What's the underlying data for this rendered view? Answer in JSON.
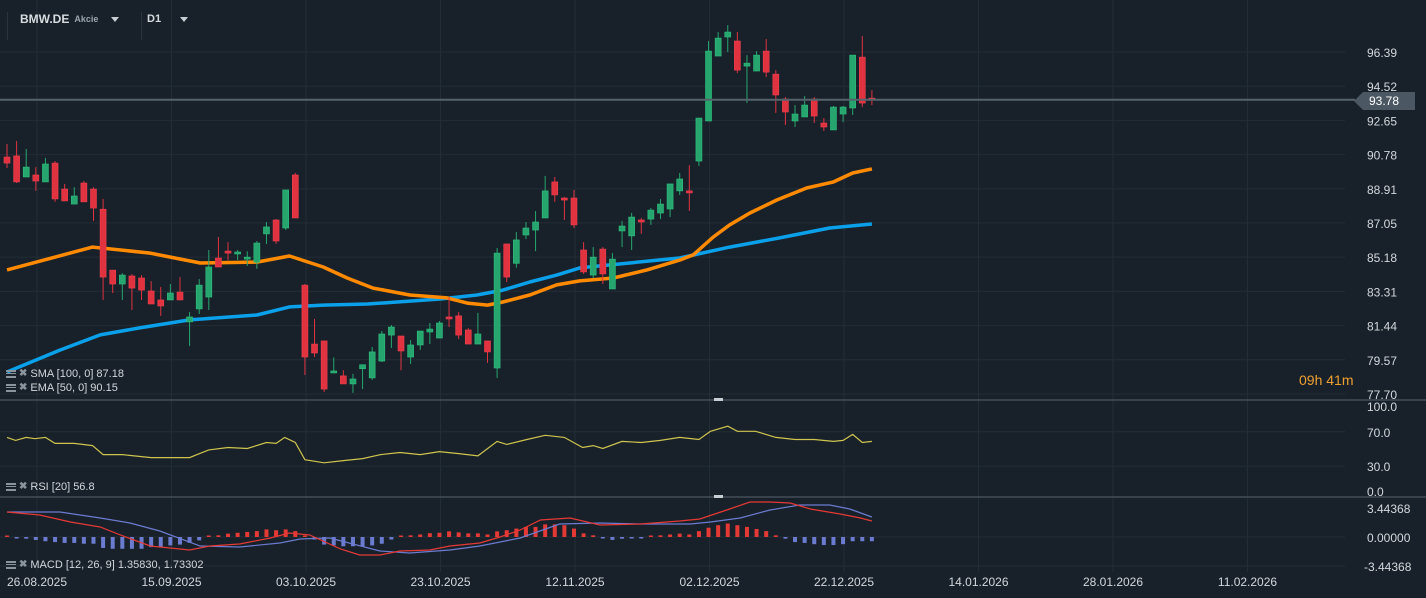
{
  "header": {
    "symbol": "BMW.DE",
    "type": "Akcie",
    "timeframe": "D1"
  },
  "indicators": {
    "sma": "SMA [100,  0] 87.18",
    "ema": "EMA [50,  0] 90.15",
    "rsi": "RSI [20]  56.8",
    "macd": "MACD [12, 26, 9] 1.35830,  1.73302"
  },
  "countdown": "09h 41m",
  "last_price": "93.78",
  "colors": {
    "bg": "#18212a",
    "up": "#26a66e",
    "down": "#e0323f",
    "ema": "#ff8a00",
    "sma": "#0aa0ea",
    "rsi": "#cfc44e",
    "macd": "#6b7bd0",
    "signal": "#e53935",
    "grid": "#232d36"
  },
  "chart_data": {
    "type": "candlestick",
    "price_axis": {
      "ticks": [
        "96.39",
        "94.52",
        "92.65",
        "90.78",
        "88.91",
        "87.05",
        "85.18",
        "83.31",
        "81.44",
        "79.57",
        "77.70"
      ],
      "range": [
        77.7,
        96.39
      ]
    },
    "time_axis": [
      "26.08.2025",
      "15.09.2025",
      "03.10.2025",
      "23.10.2025",
      "12.11.2025",
      "02.12.2025",
      "22.12.2025",
      "14.01.2026",
      "28.01.2026",
      "11.02.2026"
    ],
    "ohlc": [
      [
        90.65,
        91.36,
        90.05,
        90.32
      ],
      [
        90.71,
        91.53,
        89.23,
        89.29
      ],
      [
        89.56,
        91.09,
        89.56,
        90.1
      ],
      [
        89.67,
        90.1,
        88.8,
        89.34
      ],
      [
        89.29,
        90.6,
        89.29,
        90.27
      ],
      [
        90.32,
        90.43,
        88.2,
        88.36
      ],
      [
        88.9,
        89.18,
        88.25,
        88.25
      ],
      [
        88.08,
        89.0,
        88.08,
        88.52
      ],
      [
        89.23,
        89.34,
        88.2,
        88.2
      ],
      [
        88.9,
        89.0,
        87.16,
        87.86
      ],
      [
        87.8,
        88.36,
        82.84,
        84.09
      ],
      [
        84.47,
        84.47,
        83.22,
        83.71
      ],
      [
        83.71,
        84.3,
        82.84,
        84.2
      ],
      [
        84.15,
        84.25,
        82.29,
        83.49
      ],
      [
        84.04,
        84.2,
        82.84,
        83.38
      ],
      [
        83.33,
        83.87,
        82.62,
        82.62
      ],
      [
        82.84,
        83.55,
        81.97,
        82.51
      ],
      [
        82.84,
        83.71,
        82.84,
        83.22
      ],
      [
        83.27,
        84.09,
        82.84,
        82.84
      ],
      [
        81.64,
        82.18,
        80.32,
        81.91
      ],
      [
        82.35,
        83.98,
        82.07,
        83.65
      ],
      [
        83.0,
        85.57,
        82.29,
        84.64
      ],
      [
        85.13,
        86.28,
        84.64,
        84.64
      ],
      [
        85.51,
        86.0,
        85.0,
        85.4
      ],
      [
        85.4,
        85.57,
        85.02,
        85.46
      ],
      [
        85.07,
        85.5,
        84.7,
        85.18
      ],
      [
        84.9,
        86.06,
        84.54,
        85.95
      ],
      [
        86.45,
        87.1,
        85.9,
        86.83
      ],
      [
        87.21,
        87.26,
        85.9,
        86.06
      ],
      [
        86.77,
        88.85,
        86.66,
        88.85
      ],
      [
        89.67,
        89.78,
        87.32,
        87.32
      ],
      [
        83.65,
        83.71,
        78.74,
        79.72
      ],
      [
        80.43,
        81.8,
        79.72,
        79.94
      ],
      [
        80.6,
        80.6,
        77.81,
        77.97
      ],
      [
        78.86,
        79.7,
        78.86,
        78.96
      ],
      [
        78.69,
        79.0,
        78.25,
        78.25
      ],
      [
        78.25,
        78.8,
        77.76,
        78.52
      ],
      [
        79.08,
        79.3,
        77.97,
        79.3
      ],
      [
        78.58,
        80.27,
        78.47,
        80.0
      ],
      [
        79.5,
        81.14,
        79.45,
        80.98
      ],
      [
        80.92,
        81.47,
        80.22,
        81.36
      ],
      [
        80.87,
        80.87,
        79.0,
        80.05
      ],
      [
        79.72,
        80.65,
        79.34,
        80.38
      ],
      [
        80.38,
        81.14,
        80.11,
        81.14
      ],
      [
        81.09,
        81.58,
        80.43,
        81.25
      ],
      [
        80.76,
        81.69,
        80.76,
        81.58
      ],
      [
        81.91,
        83.0,
        81.36,
        81.8
      ],
      [
        81.97,
        82.18,
        80.7,
        80.92
      ],
      [
        81.2,
        81.3,
        80.43,
        80.43
      ],
      [
        80.43,
        82.13,
        80.43,
        80.98
      ],
      [
        80.6,
        80.6,
        79.4,
        80.0
      ],
      [
        79.12,
        85.68,
        78.58,
        85.4
      ],
      [
        85.9,
        85.9,
        83.82,
        84.09
      ],
      [
        84.84,
        86.55,
        84.6,
        86.12
      ],
      [
        86.39,
        87.1,
        86.17,
        86.77
      ],
      [
        86.66,
        87.7,
        85.51,
        87.1
      ],
      [
        87.32,
        89.62,
        87.32,
        88.8
      ],
      [
        89.29,
        89.56,
        88.2,
        88.58
      ],
      [
        88.41,
        88.47,
        87.21,
        88.3
      ],
      [
        88.41,
        88.85,
        86.77,
        86.94
      ],
      [
        85.57,
        86.0,
        84.26,
        84.37
      ],
      [
        84.2,
        85.73,
        84.04,
        85.18
      ],
      [
        85.62,
        85.73,
        83.71,
        84.26
      ],
      [
        83.44,
        85.4,
        83.44,
        85.07
      ],
      [
        86.61,
        87.16,
        85.73,
        86.88
      ],
      [
        86.34,
        87.6,
        85.57,
        87.37
      ],
      [
        87.21,
        87.32,
        86.45,
        87.1
      ],
      [
        87.26,
        87.86,
        86.94,
        87.75
      ],
      [
        87.59,
        88.36,
        87.26,
        88.08
      ],
      [
        87.81,
        89.18,
        87.37,
        89.18
      ],
      [
        88.8,
        89.78,
        88.58,
        89.45
      ],
      [
        88.8,
        90.21,
        87.7,
        88.69
      ],
      [
        90.43,
        92.78,
        90.16,
        92.78
      ],
      [
        92.62,
        96.99,
        92.62,
        96.44
      ],
      [
        96.17,
        97.48,
        96.17,
        97.15
      ],
      [
        97.21,
        97.86,
        96.39,
        97.48
      ],
      [
        96.99,
        97.48,
        95.24,
        95.4
      ],
      [
        95.62,
        96.22,
        93.6,
        95.78
      ],
      [
        95.35,
        96.44,
        95.35,
        96.22
      ],
      [
        96.44,
        97.1,
        95.02,
        95.29
      ],
      [
        95.18,
        95.4,
        93.06,
        94.04
      ],
      [
        93.82,
        93.93,
        92.4,
        93.11
      ],
      [
        92.62,
        93.49,
        92.29,
        93.0
      ],
      [
        92.84,
        93.98,
        92.84,
        93.49
      ],
      [
        93.82,
        93.93,
        92.51,
        92.89
      ],
      [
        92.51,
        92.78,
        92.07,
        92.29
      ],
      [
        92.13,
        93.44,
        92.13,
        93.38
      ],
      [
        93.0,
        93.44,
        92.56,
        93.38
      ],
      [
        93.33,
        96.22,
        92.95,
        96.22
      ],
      [
        96.11,
        97.26,
        93.38,
        93.6
      ],
      [
        93.87,
        94.31,
        93.49,
        93.76
      ]
    ],
    "last": 93.78,
    "ema50": [
      [
        0,
        84.48
      ],
      [
        8.9,
        85.73
      ],
      [
        14.9,
        85.4
      ],
      [
        20.1,
        84.86
      ],
      [
        26,
        84.91
      ],
      [
        29.4,
        85.24
      ],
      [
        32.9,
        84.64
      ],
      [
        35.4,
        84.04
      ],
      [
        38.1,
        83.49
      ],
      [
        41.9,
        83.11
      ],
      [
        45.8,
        82.95
      ],
      [
        47.9,
        82.67
      ],
      [
        50,
        82.56
      ],
      [
        51.6,
        82.73
      ],
      [
        54.4,
        83.11
      ],
      [
        57.2,
        83.66
      ],
      [
        59.6,
        83.88
      ],
      [
        63.1,
        84.04
      ],
      [
        66.6,
        84.48
      ],
      [
        70,
        85.02
      ],
      [
        71.4,
        85.3
      ],
      [
        73.5,
        86.28
      ],
      [
        75.2,
        86.94
      ],
      [
        77.3,
        87.59
      ],
      [
        80.1,
        88.3
      ],
      [
        83.2,
        88.96
      ],
      [
        86,
        89.29
      ],
      [
        88,
        89.78
      ],
      [
        90,
        90.0
      ]
    ],
    "sma100": [
      [
        0,
        78.9
      ],
      [
        5.5,
        80.1
      ],
      [
        9.7,
        80.93
      ],
      [
        13.8,
        81.31
      ],
      [
        19,
        81.75
      ],
      [
        26,
        82.02
      ],
      [
        29.4,
        82.46
      ],
      [
        32.9,
        82.56
      ],
      [
        37.5,
        82.62
      ],
      [
        45.1,
        82.89
      ],
      [
        48.9,
        83.11
      ],
      [
        51.6,
        83.38
      ],
      [
        54.4,
        83.82
      ],
      [
        57.2,
        84.2
      ],
      [
        59.6,
        84.59
      ],
      [
        61.7,
        84.7
      ],
      [
        70,
        85.13
      ],
      [
        75.2,
        85.73
      ],
      [
        80.4,
        86.23
      ],
      [
        85.6,
        86.77
      ],
      [
        90,
        86.99
      ]
    ],
    "rsi": {
      "ticks": [
        "100.0",
        "70.0",
        "30.0",
        "0.0"
      ],
      "levels": [
        100,
        70,
        30,
        0
      ],
      "values": [
        [
          0,
          63.5
        ],
        [
          0.9,
          60
        ],
        [
          2,
          63.5
        ],
        [
          2.9,
          62
        ],
        [
          4,
          63.5
        ],
        [
          5,
          56.5
        ],
        [
          7,
          56.5
        ],
        [
          8.9,
          54
        ],
        [
          10,
          43.5
        ],
        [
          12,
          43.5
        ],
        [
          15,
          40
        ],
        [
          17,
          40
        ],
        [
          19,
          40
        ],
        [
          20.1,
          45
        ],
        [
          21,
          49
        ],
        [
          23,
          51.8
        ],
        [
          25,
          50.6
        ],
        [
          27,
          57.6
        ],
        [
          28,
          56.5
        ],
        [
          28.9,
          63.5
        ],
        [
          30,
          57.6
        ],
        [
          31,
          37.6
        ],
        [
          33,
          34
        ],
        [
          35,
          36.5
        ],
        [
          37,
          38.8
        ],
        [
          38.9,
          43.5
        ],
        [
          40.9,
          45.9
        ],
        [
          43,
          43.5
        ],
        [
          45,
          47
        ],
        [
          47,
          44.7
        ],
        [
          49,
          42
        ],
        [
          51,
          58.8
        ],
        [
          52,
          55.3
        ],
        [
          54.1,
          61
        ],
        [
          56,
          65.9
        ],
        [
          58,
          63.5
        ],
        [
          59.9,
          51.8
        ],
        [
          61,
          54
        ],
        [
          62,
          50.6
        ],
        [
          64,
          58.8
        ],
        [
          66,
          57.6
        ],
        [
          68,
          60
        ],
        [
          70,
          63.5
        ],
        [
          72,
          61
        ],
        [
          73.2,
          70.6
        ],
        [
          75,
          76.5
        ],
        [
          76,
          70.6
        ],
        [
          77.9,
          70.6
        ],
        [
          80,
          63.5
        ],
        [
          82,
          61
        ],
        [
          84,
          61
        ],
        [
          86,
          58.8
        ],
        [
          87,
          60
        ],
        [
          88,
          67
        ],
        [
          89,
          57.6
        ],
        [
          90,
          58.8
        ]
      ]
    },
    "macd": {
      "ticks": [
        "3.44368",
        "0.00000",
        "-3.44368"
      ],
      "levels": [
        3.44368,
        0,
        -3.44368
      ],
      "macd_line": [
        [
          0,
          2.97
        ],
        [
          5.5,
          2.97
        ],
        [
          9.7,
          2.25
        ],
        [
          12.8,
          1.66
        ],
        [
          15.9,
          0.71
        ],
        [
          20.1,
          -1.07
        ],
        [
          24.2,
          -1.19
        ],
        [
          28.4,
          -0.71
        ],
        [
          30.5,
          -0.24
        ],
        [
          33.6,
          -0.12
        ],
        [
          38.8,
          -1.66
        ],
        [
          41.9,
          -1.9
        ],
        [
          46.1,
          -1.54
        ],
        [
          49.2,
          -1.07
        ],
        [
          53.4,
          -0.12
        ],
        [
          57.5,
          1.54
        ],
        [
          61.7,
          1.66
        ],
        [
          65.9,
          1.54
        ],
        [
          71.1,
          1.54
        ],
        [
          73.2,
          1.78
        ],
        [
          76.3,
          2.25
        ],
        [
          79.4,
          3.2
        ],
        [
          82.5,
          3.8
        ],
        [
          85.6,
          3.8
        ],
        [
          87.7,
          3.32
        ],
        [
          90,
          2.37
        ]
      ],
      "signal_line": [
        [
          0,
          2.97
        ],
        [
          3.4,
          2.61
        ],
        [
          6.6,
          1.78
        ],
        [
          9.7,
          1.19
        ],
        [
          11.8,
          0.24
        ],
        [
          14.9,
          -1.07
        ],
        [
          19,
          -1.54
        ],
        [
          21.1,
          -1.07
        ],
        [
          24.2,
          -0.83
        ],
        [
          27.4,
          -0.12
        ],
        [
          29.4,
          0.47
        ],
        [
          31.5,
          0.24
        ],
        [
          34.7,
          -1.42
        ],
        [
          36.7,
          -2.14
        ],
        [
          38.8,
          -2.14
        ],
        [
          40.9,
          -1.66
        ],
        [
          44,
          -1.54
        ],
        [
          46.1,
          -1.07
        ],
        [
          49.2,
          -0.71
        ],
        [
          51.3,
          0
        ],
        [
          53.4,
          0.83
        ],
        [
          55.5,
          2.02
        ],
        [
          58.6,
          2.25
        ],
        [
          61.7,
          1.42
        ],
        [
          65.9,
          1.54
        ],
        [
          70,
          1.9
        ],
        [
          72.1,
          2.14
        ],
        [
          75.2,
          3.32
        ],
        [
          77.3,
          4.15
        ],
        [
          79.4,
          4.15
        ],
        [
          81.5,
          4.03
        ],
        [
          83.6,
          3.32
        ],
        [
          86.7,
          2.73
        ],
        [
          88.8,
          2.25
        ],
        [
          90,
          1.9
        ]
      ],
      "histogram": [
        0.05,
        -0.1,
        -0.2,
        -0.35,
        -0.5,
        -0.6,
        -0.7,
        -0.7,
        -0.8,
        -0.8,
        -1.3,
        -1.4,
        -1.4,
        -1.4,
        -1.4,
        -1.2,
        -1.2,
        -1.0,
        -0.9,
        -0.7,
        -0.4,
        0,
        0.2,
        0.4,
        0.5,
        0.6,
        0.7,
        0.9,
        0.8,
        0.9,
        0.7,
        0.1,
        -0.3,
        -0.9,
        -1.0,
        -1.1,
        -1.1,
        -1.1,
        -1.0,
        -0.8,
        -0.3,
        0,
        0.2,
        0.3,
        0.45,
        0.5,
        0.67,
        0.55,
        0.43,
        0.43,
        0.3,
        0.67,
        0.8,
        1.0,
        1.2,
        1.2,
        1.5,
        1.5,
        1.4,
        1.0,
        0.43,
        0.2,
        -0.05,
        -0.35,
        -0.2,
        -0.1,
        -0.1,
        0.1,
        0.2,
        0.3,
        0.4,
        0.3,
        0.7,
        1.1,
        1.4,
        1.6,
        1.4,
        1.2,
        0.95,
        0.7,
        0.2,
        -0.2,
        -0.6,
        -0.7,
        -0.85,
        -0.95,
        -0.95,
        -0.85,
        -0.5,
        -0.5,
        -0.5
      ]
    }
  }
}
